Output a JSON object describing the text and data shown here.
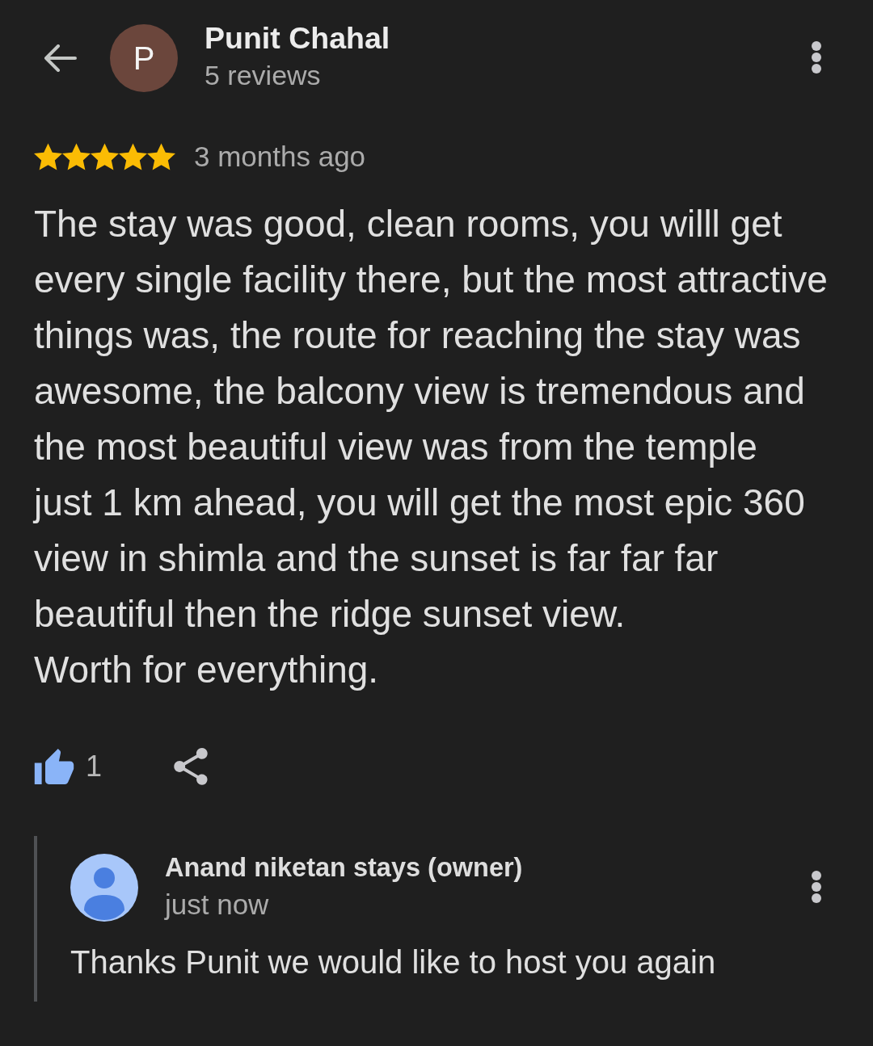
{
  "header": {
    "avatar_initial": "P",
    "author_name": "Punit Chahal",
    "review_count": "5 reviews"
  },
  "review": {
    "stars": 5,
    "time": "3 months ago",
    "paragraphs": [
      "The stay was good, clean rooms, you willl get\nevery single facility there, but the most attractive\nthings was, the route for reaching the stay was\nawesome, the balcony view is tremendous and\nthe most beautiful view was from the temple\njust 1 km ahead, you will get the most epic 360\nview in shimla and the sunset is far far far\nbeautiful then the ridge sunset view.",
      "Worth for everything."
    ],
    "liked": true,
    "like_count": "1"
  },
  "reply": {
    "author": "Anand niketan stays (owner)",
    "time": "just now",
    "text": "Thanks Punit we would like to host you again"
  }
}
